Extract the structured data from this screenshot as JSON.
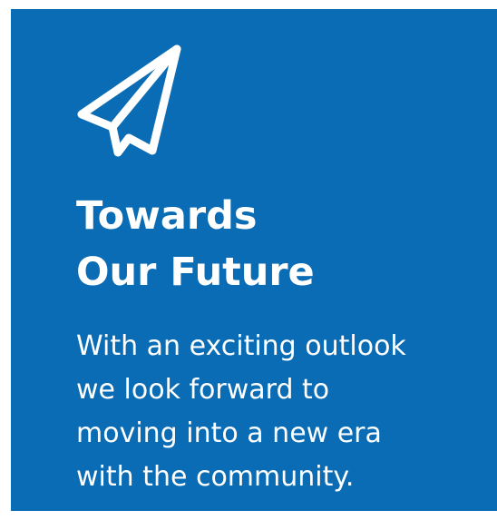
{
  "card": {
    "background_color": "#0A6CB4",
    "icon": "paper-plane-icon",
    "title_lines": [
      "Towards",
      "Our Future"
    ],
    "description_lines": [
      "With an exciting outlook",
      "we look forward to",
      "moving into a new era",
      "with the community."
    ]
  }
}
